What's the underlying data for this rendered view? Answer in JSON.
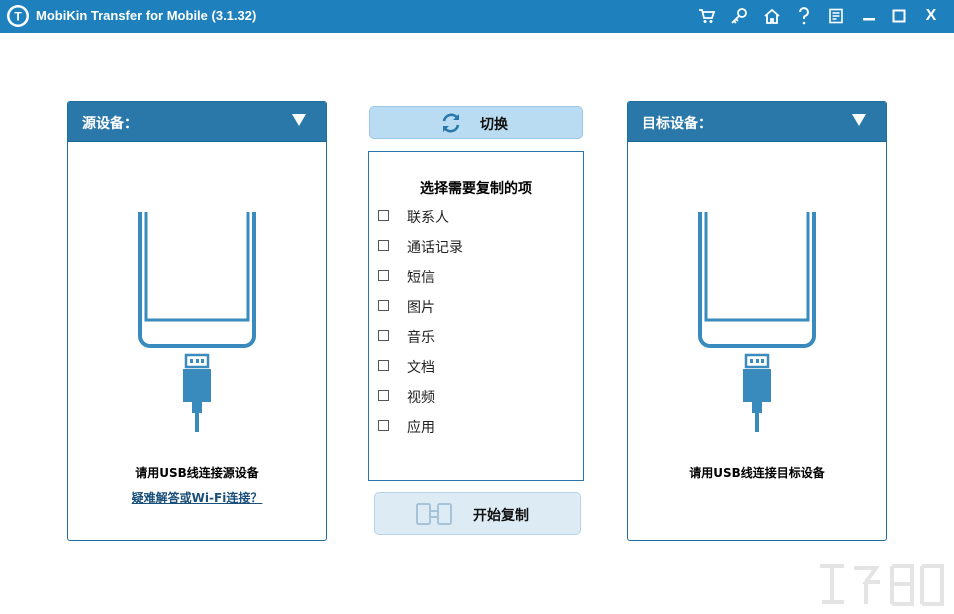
{
  "window": {
    "title": "MobiKin Transfer for Mobile  (3.1.32)",
    "close_label": "X"
  },
  "source_panel": {
    "label": "源设备：",
    "hint": "请用USB线连接源设备",
    "help_link": "疑难解答或Wi-Fi连接？"
  },
  "target_panel": {
    "label": "目标设备：",
    "hint": "请用USB线连接目标设备"
  },
  "switch_button": {
    "label": "切换"
  },
  "selection": {
    "title": "选择需要复制的项",
    "items": [
      {
        "label": "联系人",
        "checked": false
      },
      {
        "label": "通话记录",
        "checked": false
      },
      {
        "label": "短信",
        "checked": false
      },
      {
        "label": "图片",
        "checked": false
      },
      {
        "label": "音乐",
        "checked": false
      },
      {
        "label": "文档",
        "checked": false
      },
      {
        "label": "视频",
        "checked": false
      },
      {
        "label": "应用",
        "checked": false
      }
    ]
  },
  "copy_button": {
    "label": "开始复制"
  },
  "colors": {
    "titlebar": "#1e81be",
    "panel_header": "#2a78aa",
    "phone": "#3a8bbd",
    "switch_bg": "#b9dcf2",
    "copy_bg": "#ddebf5"
  }
}
